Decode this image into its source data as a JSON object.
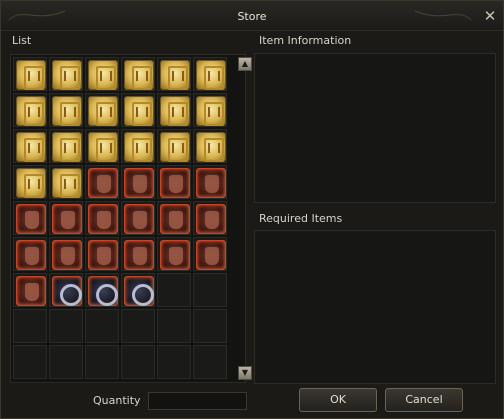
{
  "window": {
    "title": "Store",
    "close_glyph": "✕"
  },
  "labels": {
    "list": "List",
    "item_information": "Item Information",
    "required_items": "Required Items",
    "quantity": "Quantity"
  },
  "quantity_value": "",
  "buttons": {
    "ok": "OK",
    "cancel": "Cancel"
  },
  "scroll": {
    "up_glyph": "▲",
    "down_glyph": "▼"
  },
  "grid": {
    "columns": 6,
    "rows": 9,
    "slots": [
      "scroll",
      "scroll",
      "scroll",
      "scroll",
      "scroll",
      "scroll",
      "scroll",
      "scroll",
      "scroll",
      "scroll",
      "scroll",
      "scroll",
      "scroll",
      "scroll",
      "scroll",
      "scroll",
      "scroll",
      "scroll",
      "scroll",
      "scroll",
      "armor",
      "armor",
      "armor",
      "armor",
      "armor",
      "armor",
      "armor",
      "armor",
      "armor",
      "armor",
      "armor",
      "armor",
      "armor",
      "armor",
      "armor",
      "armor",
      "armor",
      "ring",
      "ring",
      "ring",
      "empty",
      "empty",
      "empty",
      "empty",
      "empty",
      "empty",
      "empty",
      "empty",
      "empty",
      "empty",
      "empty",
      "empty",
      "empty",
      "empty"
    ]
  },
  "colors": {
    "background": "#1b1a17",
    "slot_border_highlight": "#c4452a",
    "scroll_gold": "#d9b54f"
  }
}
